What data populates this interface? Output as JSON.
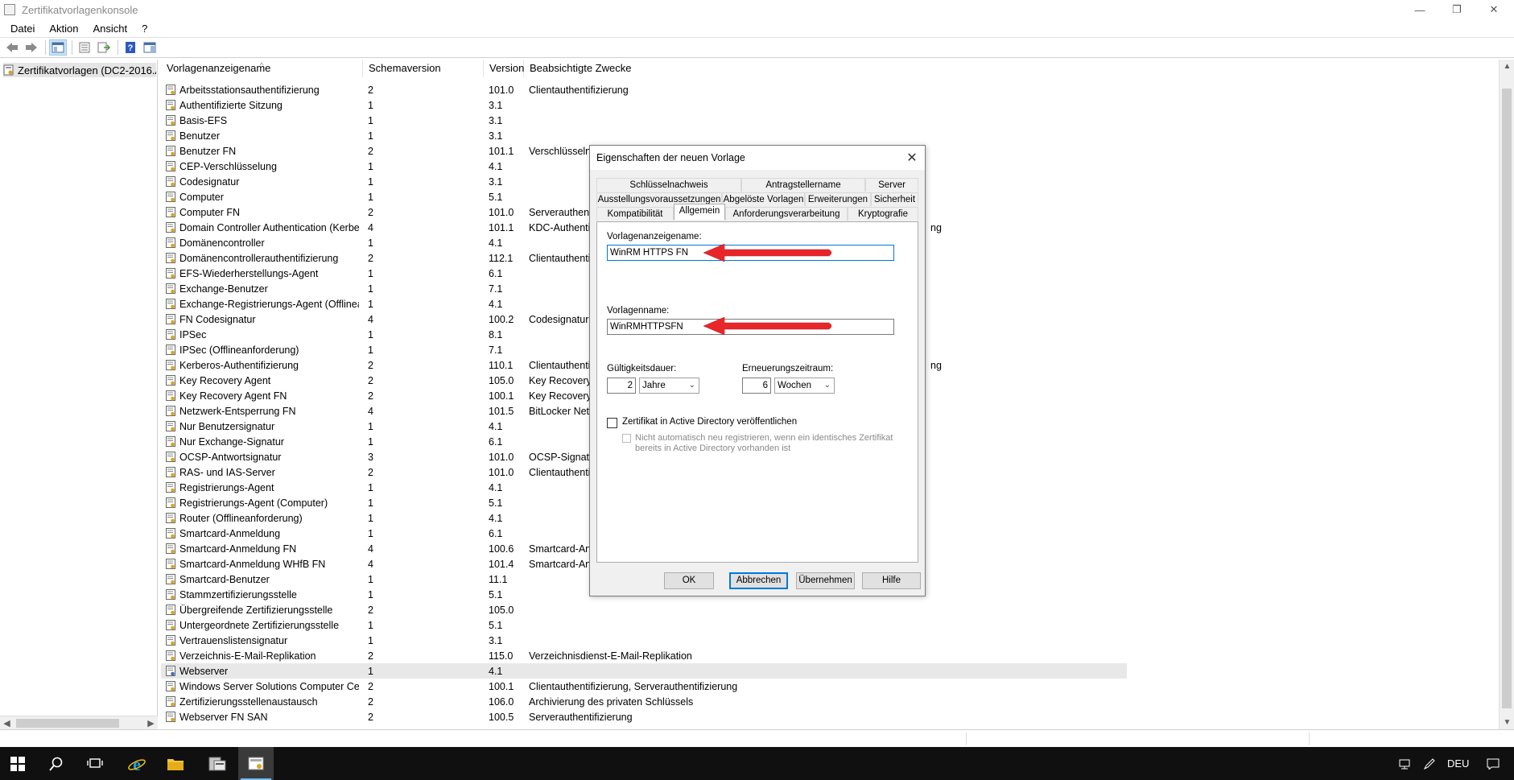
{
  "window": {
    "title": "Zertifikatvorlagenkonsole",
    "minimize_glyph": "—",
    "restore_glyph": "❐",
    "close_glyph": "✕"
  },
  "menu": [
    "Datei",
    "Aktion",
    "Ansicht",
    "?"
  ],
  "toolbar": {
    "icons": [
      "back-arrow-icon",
      "forward-arrow-icon",
      "show-tree-icon",
      "properties-icon",
      "export-list-icon",
      "help-icon",
      "action-pane-icon"
    ]
  },
  "tree": {
    "root_label": "Zertifikatvorlagen (DC2-2016.AD"
  },
  "list": {
    "columns": [
      "Vorlagenanzeigename",
      "Schemaversion",
      "Version",
      "Beabsichtigte Zwecke"
    ],
    "rows": [
      {
        "name": "Arbeitsstationsauthentifizierung",
        "schema": "2",
        "version": "101.0",
        "purpose": "Clientauthentifizierung"
      },
      {
        "name": "Authentifizierte Sitzung",
        "schema": "1",
        "version": "3.1",
        "purpose": ""
      },
      {
        "name": "Basis-EFS",
        "schema": "1",
        "version": "3.1",
        "purpose": ""
      },
      {
        "name": "Benutzer",
        "schema": "1",
        "version": "3.1",
        "purpose": ""
      },
      {
        "name": "Benutzer FN",
        "schema": "2",
        "version": "101.1",
        "purpose": "Verschlüsselnd"
      },
      {
        "name": "CEP-Verschlüsselung",
        "schema": "1",
        "version": "4.1",
        "purpose": ""
      },
      {
        "name": "Codesignatur",
        "schema": "1",
        "version": "3.1",
        "purpose": ""
      },
      {
        "name": "Computer",
        "schema": "1",
        "version": "5.1",
        "purpose": ""
      },
      {
        "name": "Computer FN",
        "schema": "2",
        "version": "101.0",
        "purpose": "Serverauthenti"
      },
      {
        "name": "Domain Controller Authentication (Kerbe...",
        "schema": "4",
        "version": "101.1",
        "purpose": "KDC-Authenti",
        "purpose_tail": "ng"
      },
      {
        "name": "Domänencontroller",
        "schema": "1",
        "version": "4.1",
        "purpose": ""
      },
      {
        "name": "Domänencontrollerauthentifizierung",
        "schema": "2",
        "version": "112.1",
        "purpose": "Clientauthenti"
      },
      {
        "name": "EFS-Wiederherstellungs-Agent",
        "schema": "1",
        "version": "6.1",
        "purpose": ""
      },
      {
        "name": "Exchange-Benutzer",
        "schema": "1",
        "version": "7.1",
        "purpose": ""
      },
      {
        "name": "Exchange-Registrierungs-Agent (Offlinea...",
        "schema": "1",
        "version": "4.1",
        "purpose": ""
      },
      {
        "name": "FN Codesignatur",
        "schema": "4",
        "version": "100.2",
        "purpose": "Codesignatur"
      },
      {
        "name": "IPSec",
        "schema": "1",
        "version": "8.1",
        "purpose": ""
      },
      {
        "name": "IPSec (Offlineanforderung)",
        "schema": "1",
        "version": "7.1",
        "purpose": ""
      },
      {
        "name": "Kerberos-Authentifizierung",
        "schema": "2",
        "version": "110.1",
        "purpose": "Clientauthenti",
        "purpose_tail": "ng"
      },
      {
        "name": "Key Recovery Agent",
        "schema": "2",
        "version": "105.0",
        "purpose": "Key Recovery A"
      },
      {
        "name": "Key Recovery Agent FN",
        "schema": "2",
        "version": "100.1",
        "purpose": "Key Recovery A"
      },
      {
        "name": "Netzwerk-Entsperrung FN",
        "schema": "4",
        "version": "101.5",
        "purpose": "BitLocker Netz"
      },
      {
        "name": "Nur Benutzersignatur",
        "schema": "1",
        "version": "4.1",
        "purpose": ""
      },
      {
        "name": "Nur Exchange-Signatur",
        "schema": "1",
        "version": "6.1",
        "purpose": ""
      },
      {
        "name": "OCSP-Antwortsignatur",
        "schema": "3",
        "version": "101.0",
        "purpose": "OCSP-Signatu"
      },
      {
        "name": "RAS- und IAS-Server",
        "schema": "2",
        "version": "101.0",
        "purpose": "Clientauthenti"
      },
      {
        "name": "Registrierungs-Agent",
        "schema": "1",
        "version": "4.1",
        "purpose": ""
      },
      {
        "name": "Registrierungs-Agent (Computer)",
        "schema": "1",
        "version": "5.1",
        "purpose": ""
      },
      {
        "name": "Router (Offlineanforderung)",
        "schema": "1",
        "version": "4.1",
        "purpose": ""
      },
      {
        "name": "Smartcard-Anmeldung",
        "schema": "1",
        "version": "6.1",
        "purpose": ""
      },
      {
        "name": "Smartcard-Anmeldung FN",
        "schema": "4",
        "version": "100.6",
        "purpose": "Smartcard-An"
      },
      {
        "name": "Smartcard-Anmeldung WHfB FN",
        "schema": "4",
        "version": "101.4",
        "purpose": "Smartcard-An"
      },
      {
        "name": "Smartcard-Benutzer",
        "schema": "1",
        "version": "11.1",
        "purpose": ""
      },
      {
        "name": "Stammzertifizierungsstelle",
        "schema": "1",
        "version": "5.1",
        "purpose": ""
      },
      {
        "name": "Übergreifende Zertifizierungsstelle",
        "schema": "2",
        "version": "105.0",
        "purpose": ""
      },
      {
        "name": "Untergeordnete Zertifizierungsstelle",
        "schema": "1",
        "version": "5.1",
        "purpose": ""
      },
      {
        "name": "Vertrauenslistensignatur",
        "schema": "1",
        "version": "3.1",
        "purpose": ""
      },
      {
        "name": "Verzeichnis-E-Mail-Replikation",
        "schema": "2",
        "version": "115.0",
        "purpose": "Verzeichnisdienst-E-Mail-Replikation"
      },
      {
        "name": "Webserver",
        "schema": "1",
        "version": "4.1",
        "purpose": "",
        "selected": true
      },
      {
        "name": "Windows Server Solutions Computer Cer...",
        "schema": "2",
        "version": "100.1",
        "purpose": "Clientauthentifizierung, Serverauthentifizierung"
      },
      {
        "name": "Zertifizierungsstellenaustausch",
        "schema": "2",
        "version": "106.0",
        "purpose": "Archivierung des privaten Schlüssels"
      },
      {
        "name": "Webserver FN SAN",
        "schema": "2",
        "version": "100.5",
        "purpose": "Serverauthentifizierung"
      }
    ]
  },
  "dialog": {
    "title": "Eigenschaften der neuen Vorlage",
    "tabs_row1": [
      "Schlüsselnachweis",
      "Antragstellername",
      "Server"
    ],
    "tabs_row2": [
      "Ausstellungsvoraussetzungen",
      "Abgelöste Vorlagen",
      "Erweiterungen",
      "Sicherheit"
    ],
    "tabs_row3": [
      "Kompatibilität",
      "Allgemein",
      "Anforderungsverarbeitung",
      "Kryptografie"
    ],
    "display_name_label": "Vorlagenanzeigename:",
    "display_name_value": "WinRM HTTPS FN",
    "template_name_label": "Vorlagenname:",
    "template_name_value": "WinRMHTTPSFN",
    "validity_label": "Gültigkeitsdauer:",
    "validity_value": "2",
    "validity_unit": "Jahre",
    "renewal_label": "Erneuerungszeitraum:",
    "renewal_value": "6",
    "renewal_unit": "Wochen",
    "publish_ad_label": "Zertifikat in Active Directory veröffentlichen",
    "no_reenroll_label_line1": "Nicht automatisch neu registrieren, wenn ein identisches Zertifikat",
    "no_reenroll_label_line2": "bereits in Active Directory vorhanden ist",
    "buttons": {
      "ok": "OK",
      "cancel": "Abbrechen",
      "apply": "Übernehmen",
      "help": "Hilfe"
    }
  },
  "annotation_color": "#e8262a",
  "taskbar": {
    "icons": [
      "windows-start-icon",
      "search-icon",
      "task-view-icon",
      "internet-explorer-icon",
      "file-explorer-icon",
      "server-manager-icon",
      "certificate-console-icon"
    ],
    "language": "DEU"
  }
}
